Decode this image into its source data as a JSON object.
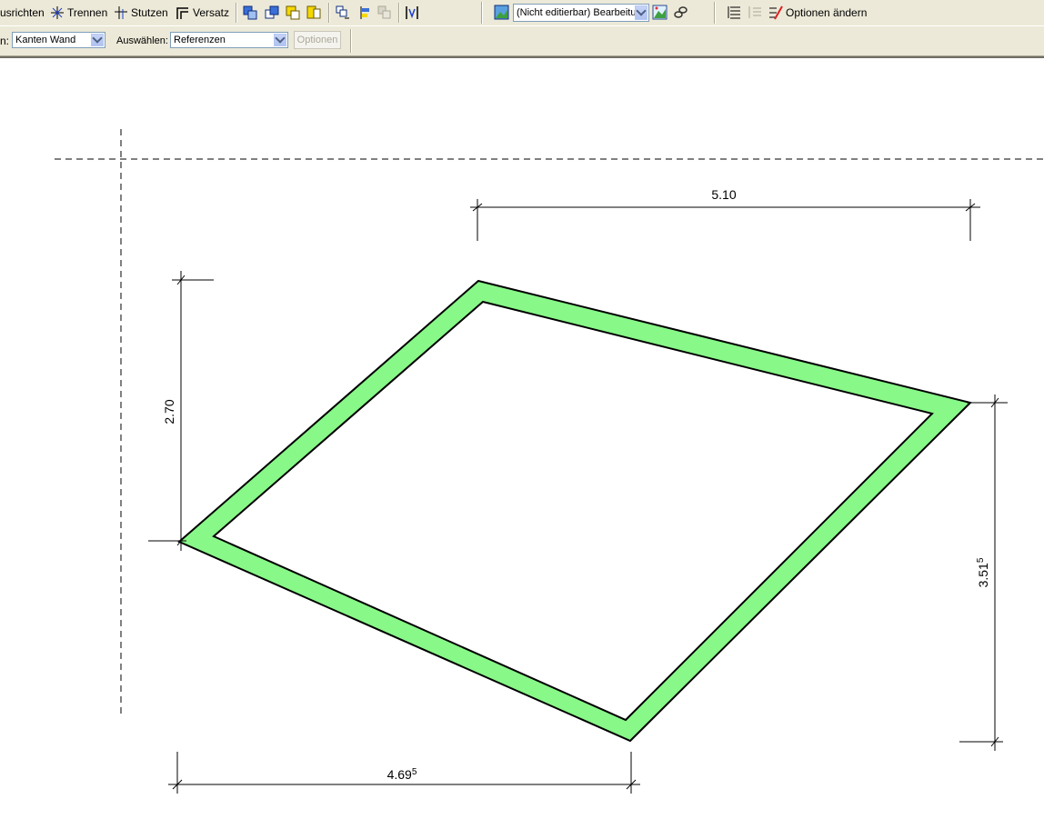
{
  "toolbar_top": {
    "ausrichten": "usrichten",
    "trennen": "Trennen",
    "stutzen": "Stutzen",
    "versatz": "Versatz",
    "display_mode": "(Nicht editierbar) Bearbeitu",
    "optionen_aendern": "Optionen ändern"
  },
  "toolbar_bottom": {
    "kanten_label": "n:",
    "kanten_value": "Kanten Wand",
    "auswaehlen_label": "Auswählen:",
    "auswaehlen_value": "Referenzen",
    "optionen": "Optionen"
  },
  "drawing": {
    "dim_top": "5.10",
    "dim_left": "2.70",
    "dim_right_main": "3.51",
    "dim_right_sup": "5",
    "dim_bottom_main": "4.69",
    "dim_bottom_sup": "5",
    "wall_color": "#88f888"
  }
}
